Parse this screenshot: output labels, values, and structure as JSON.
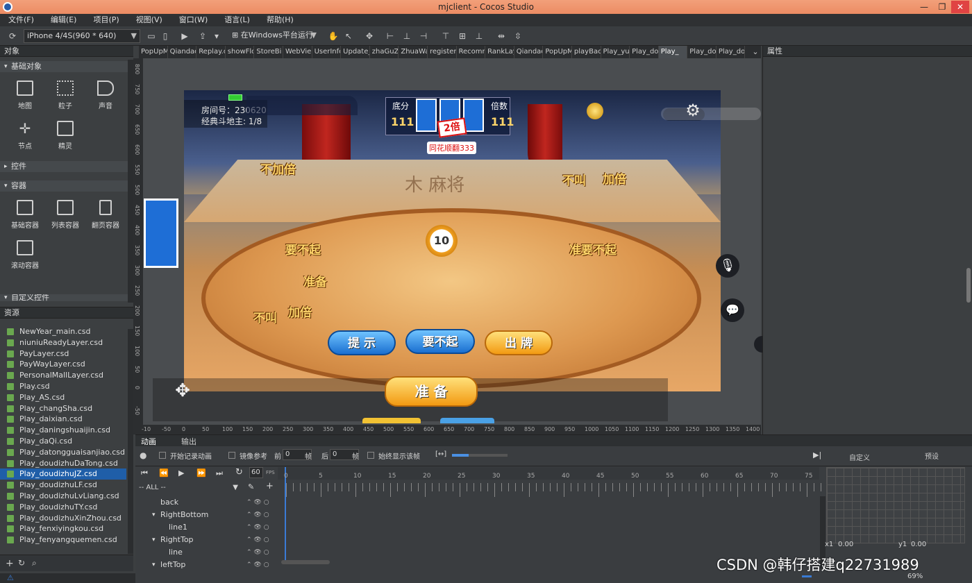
{
  "window": {
    "title": "mjclient - Cocos Studio",
    "controls": [
      "—",
      "❐",
      "✕"
    ]
  },
  "menu": [
    "文件(F)",
    "编辑(E)",
    "项目(P)",
    "视图(V)",
    "窗口(W)",
    "语言(L)",
    "帮助(H)"
  ],
  "toolbar": {
    "device": "iPhone 4/4S(960 * 640)",
    "run_target": "在Windows平台运行"
  },
  "objects_panel": {
    "title": "对象",
    "sections": {
      "basic": "基础对象",
      "controls": "控件",
      "containers": "容器",
      "custom": "自定义控件"
    },
    "basic_items": [
      "地图",
      "粒子",
      "声音",
      "节点",
      "精灵"
    ],
    "container_items": [
      "基础容器",
      "列表容器",
      "翻页容器",
      "滚动容器"
    ]
  },
  "resources_panel": {
    "title": "资源",
    "files": [
      "NewYear_main.csd",
      "niuniuReadyLayer.csd",
      "PayLayer.csd",
      "PayWayLayer.csd",
      "PersonalMallLayer.csd",
      "Play.csd",
      "Play_AS.csd",
      "Play_changSha.csd",
      "Play_daixian.csd",
      "Play_daningshuaijin.csd",
      "Play_daQi.csd",
      "Play_datongguaisanjiao.csd",
      "Play_doudizhuDaTong.csd",
      "Play_doudizhuJZ.csd",
      "Play_doudizhuLF.csd",
      "Play_doudizhuLvLiang.csd",
      "Play_doudizhuTY.csd",
      "Play_doudizhuXinZhou.csd",
      "Play_fenxiyingkou.csd",
      "Play_fenyangquemen.csd"
    ],
    "selected": "Play_doudizhuJZ.csd"
  },
  "tabs": [
    "PopUpM",
    "Qiandao",
    "Replay.c",
    "showFlo",
    "StoreBi",
    "WebVie",
    "UserInfo",
    "Update_",
    "zhaGuZ",
    "ZhuaWa",
    "register",
    "Recomm",
    "RankLay",
    "Qiandao",
    "PopUpM",
    "playBac",
    "Play_yu",
    "Play_do",
    "Play_",
    "Play_do",
    "Play_do"
  ],
  "active_tab": "Play_",
  "ruler": {
    "x": [
      "-10",
      "-50",
      "0",
      "50",
      "100",
      "150",
      "200",
      "250",
      "300",
      "350",
      "400",
      "450",
      "500",
      "550",
      "600",
      "650",
      "700",
      "750",
      "800",
      "850",
      "900",
      "950",
      "1000",
      "1050",
      "1100",
      "1150",
      "1200",
      "1250",
      "1300",
      "1350",
      "1400"
    ],
    "y": [
      "800",
      "750",
      "700",
      "650",
      "600",
      "550",
      "500",
      "450",
      "400",
      "350",
      "300",
      "250",
      "200",
      "150",
      "100",
      "50",
      "0",
      "-50"
    ]
  },
  "game": {
    "room_label": "房间号：230620",
    "mode_label": "经典斗地主: 1/8",
    "base_label": "底分",
    "base_value": "111",
    "mult_label": "倍数",
    "mult_value": "111",
    "double_badge": "2倍",
    "hand_text": "同花顺翻333",
    "table_logo": "木  麻将",
    "timer": "10",
    "texts": {
      "left_top": "不加倍",
      "right_top_a": "不叫",
      "right_top_b": "加倍",
      "left_mid": "要不起",
      "right_mid": "准要不起",
      "left_ready": "准备",
      "left_bot_a": "不叫",
      "left_bot_b": "加倍"
    },
    "buttons": {
      "hint": "提 示",
      "pass": "要不起",
      "play": "出 牌",
      "ready": "准 备"
    }
  },
  "properties_panel": {
    "title": "属性"
  },
  "animation_panel": {
    "tabs": [
      "动画",
      "输出"
    ],
    "record_label": "开始记录动画",
    "onion_label": "镜像参考",
    "prev_label": "前",
    "prev_value": "0",
    "frame_unit": "帧",
    "next_label": "后",
    "next_value": "0",
    "always_show": "始终显示该帧",
    "fps": "60",
    "fps_unit": "FPS",
    "filter": "-- ALL --",
    "custom_tab": "自定义",
    "preset_tab": "预设",
    "nodes": [
      {
        "name": "back",
        "indent": 1
      },
      {
        "name": "RightBottom",
        "indent": 1,
        "expanded": true
      },
      {
        "name": "line1",
        "indent": 2
      },
      {
        "name": "RightTop",
        "indent": 1,
        "expanded": true
      },
      {
        "name": "line",
        "indent": 2
      },
      {
        "name": "leftTop",
        "indent": 1,
        "expanded": true
      }
    ],
    "frames": [
      "0",
      "5",
      "10",
      "15",
      "20",
      "25",
      "30",
      "35",
      "40",
      "45",
      "50",
      "55",
      "60",
      "65",
      "70",
      "75"
    ],
    "x1_label": "x1",
    "x1_value": "0.00",
    "y1_label": "y1",
    "y1_value": "0.00",
    "zoom": "69%"
  },
  "watermark": "CSDN @韩仔搭建q22731989"
}
